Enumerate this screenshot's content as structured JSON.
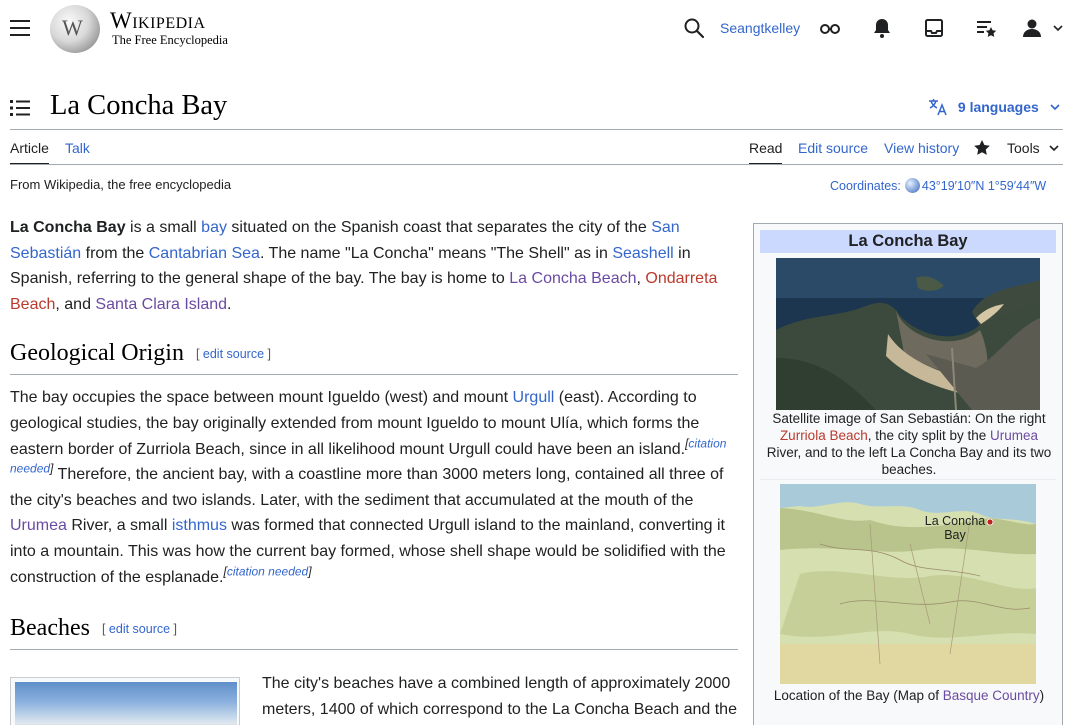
{
  "header": {
    "wordmark": "Wikipedia",
    "tagline": "The Free Encyclopedia",
    "username": "Seangtkelley"
  },
  "title": "La Concha Bay",
  "languages_label": "9 languages",
  "tabs": {
    "article": "Article",
    "talk": "Talk",
    "read": "Read",
    "edit_source": "Edit source",
    "view_history": "View history",
    "tools": "Tools"
  },
  "from_wikipedia": "From Wikipedia, the free encyclopedia",
  "coordinates": {
    "label": "Coordinates:",
    "value": "43°19′10″N 1°59′44″W"
  },
  "intro": {
    "t1": "La Concha Bay",
    "t2": " is a small ",
    "l_bay": "bay",
    "t3": " situated on the Spanish coast that separates the city of the ",
    "l_san_sebastian": "San Sebastián",
    "t4": " from the ",
    "l_cantabrian": "Cantabrian Sea",
    "t5": ". The name \"La Concha\" means \"The Shell\" as in ",
    "l_seashell": "Seashell",
    "t6": " in Spanish, referring to the general shape of the bay. The bay is home to ",
    "l_concha_beach": "La Concha Beach",
    "t7": ", ",
    "l_ondarreta": "Ondarreta Beach",
    "t8": ", and ",
    "l_santa_clara": "Santa Clara Island",
    "t9": "."
  },
  "section_geo": {
    "heading": "Geological Origin",
    "edit_open": "[ ",
    "edit_label": "edit source",
    "edit_close": " ]",
    "t1": "The bay occupies the space between mount Igueldo (west) and mount ",
    "l_urgull": "Urgull",
    "t2": " (east). According to geological studies, the bay originally extended from mount Igueldo to mount Ulía, which forms the eastern border of Zurriola Beach, since in all likelihood mount Urgull could have been an island.",
    "cn1_open": "[",
    "cn1_label": "citation needed",
    "cn1_close": "]",
    "t3": " Therefore, the ancient bay, with a coastline more than 3000 meters long, contained all three of the city's beaches and two islands. Later, with the sediment that accumulated at the mouth of the ",
    "l_urumea": "Urumea",
    "t4": " River, a small ",
    "l_isthmus": "isthmus",
    "t5": " was formed that connected Urgull island to the mainland, converting it into a mountain. This was how the current bay formed, whose shell shape would be solidified with the construction of the esplanade.",
    "cn2_open": "[",
    "cn2_label": "citation needed",
    "cn2_close": "]"
  },
  "section_beaches": {
    "heading": "Beaches",
    "edit_open": "[ ",
    "edit_label": "edit source",
    "edit_close": " ]",
    "text": "The city's beaches have a combined length of approximately 2000 meters, 1400 of which correspond to the La Concha Beach and the"
  },
  "infobox": {
    "title": "La Concha Bay",
    "caption1_a": "Satellite image of San Sebastián: On the right ",
    "caption1_l1": "Zurriola Beach",
    "caption1_b": ", the city split by the ",
    "caption1_l2": "Urumea",
    "caption1_c": " River, and to the left La Concha Bay and its two beaches.",
    "map_label_1": "La Concha",
    "map_label_2": "Bay",
    "caption2_a": "Location of the Bay (Map of ",
    "caption2_l1": "Basque Country",
    "caption2_b": ")"
  }
}
